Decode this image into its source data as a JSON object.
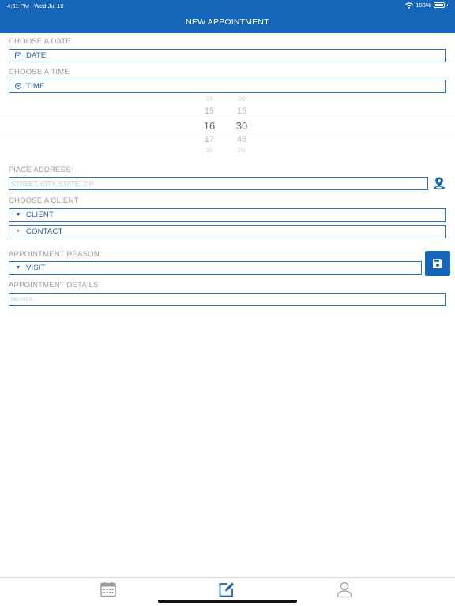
{
  "status_bar": {
    "time": "4:31 PM",
    "date": "Wed Jul 10",
    "battery": "100%"
  },
  "header": {
    "title": "NEW APPOINTMENT"
  },
  "date_section": {
    "label": "CHOOSE A DATE",
    "field_text": "DATE",
    "icon": "calendar-icon"
  },
  "time_section": {
    "label": "CHOOSE A TIME",
    "field_text": "TIME",
    "icon": "clock-icon",
    "picker": {
      "hours": [
        "14",
        "15",
        "16",
        "17",
        "18"
      ],
      "minutes": [
        "00",
        "15",
        "30",
        "45",
        "00"
      ],
      "selected_hour": "16",
      "selected_minute": "30"
    }
  },
  "address_section": {
    "label": "PlACE ADDRESS:",
    "placeholder": "STREET, CITY, STATE, ZIP",
    "icon": "location-pin-icon"
  },
  "client_section": {
    "label": "CHOOSE A CLIENT",
    "client_text": "CLIENT",
    "contact_text": "CONTACT"
  },
  "reason_section": {
    "label": "APPOINTMENT REASON",
    "value": "VISIT",
    "save_icon": "save-icon"
  },
  "details_section": {
    "label": "APPOINTMENT DETAILS",
    "placeholder": "DETAILS..."
  },
  "tabbar": {
    "tabs": [
      {
        "icon": "calendar-tab-icon",
        "active": false
      },
      {
        "icon": "edit-tab-icon",
        "active": true
      },
      {
        "icon": "person-tab-icon",
        "active": false
      }
    ]
  },
  "colors": {
    "accent": "#1565b8",
    "label": "#9a9a9a",
    "field_border": "#2a72c0",
    "inactive_tab": "#9e9e9e"
  }
}
